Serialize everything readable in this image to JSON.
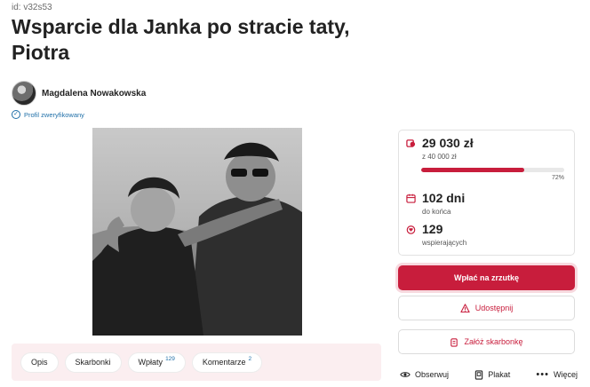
{
  "page": {
    "id_text": "id: v32s53",
    "title": "Wsparcie dla Janka po stracie taty, Piotra"
  },
  "author": {
    "name": "Magdalena Nowakowska",
    "verified_label": "Profil zweryfikowany"
  },
  "photo": {
    "icon": "photo"
  },
  "tabs": [
    {
      "label": "Opis",
      "count": ""
    },
    {
      "label": "Skarbonki",
      "count": ""
    },
    {
      "label": "Wpłaty",
      "count": "129"
    },
    {
      "label": "Komentarze",
      "count": "2"
    }
  ],
  "stats": {
    "raised": "29 030 zł",
    "goal": "z 40 000 zł",
    "progress_percent": 72,
    "progress_label": "72%",
    "days": "102 dni",
    "days_sub": "do końca",
    "supporters": "129",
    "supporters_sub": "wspierających"
  },
  "actions": {
    "donate": "Wpłać na zrzutkę",
    "share": "Udostępnij",
    "create_box": "Załóż skarbonkę",
    "watch": "Obserwuj",
    "poster": "Plakat",
    "more": "Więcej"
  },
  "colors": {
    "accent": "#c81d3c",
    "link": "#1f6fa8",
    "tabs_bg": "#fbeef0"
  }
}
